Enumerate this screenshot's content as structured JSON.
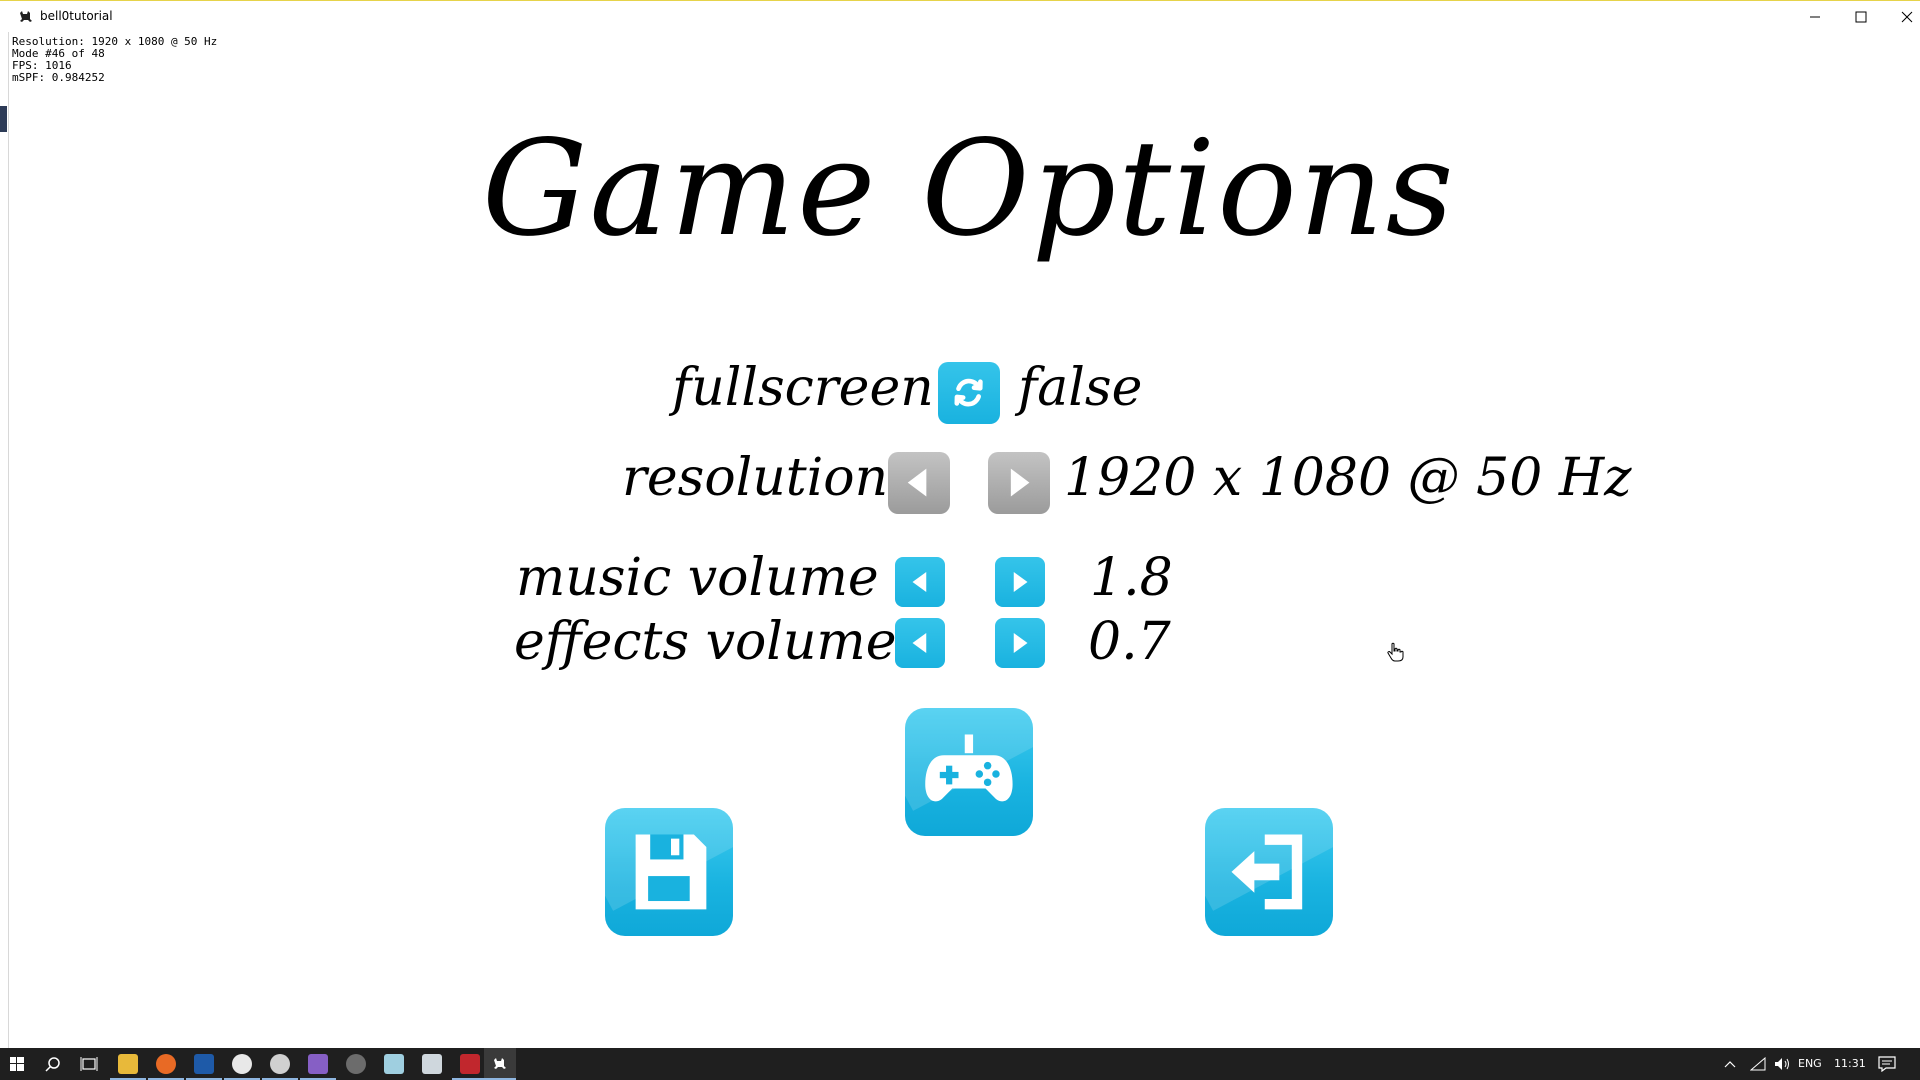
{
  "window": {
    "title": "bell0tutorial"
  },
  "debug_lines": [
    "Resolution: 1920 x 1080 @ 50 Hz",
    "Mode #46 of 48",
    "FPS: 1016",
    "mSPF: 0.984252"
  ],
  "heading": "Game Options",
  "options": {
    "fullscreen": {
      "label": "fullscreen",
      "value": "false"
    },
    "resolution": {
      "label": "resolution",
      "value": "1920 x 1080 @ 50 Hz"
    },
    "music_volume": {
      "label": "music volume",
      "value": "1.8"
    },
    "effects_volume": {
      "label": "effects volume",
      "value": "0.7"
    }
  },
  "colors": {
    "button_blue": "#19b2df",
    "button_gray": "#a6a6a6",
    "taskbar": "#1f1f1f"
  },
  "icons": {
    "fullscreen_toggle": "refresh-icon",
    "prev": "arrow-left-icon",
    "next": "arrow-right-icon",
    "save": "floppy-disk-icon",
    "play": "gamepad-icon",
    "exit": "exit-door-icon"
  },
  "taskbar": {
    "language": "ENG",
    "clock": "11:31"
  }
}
